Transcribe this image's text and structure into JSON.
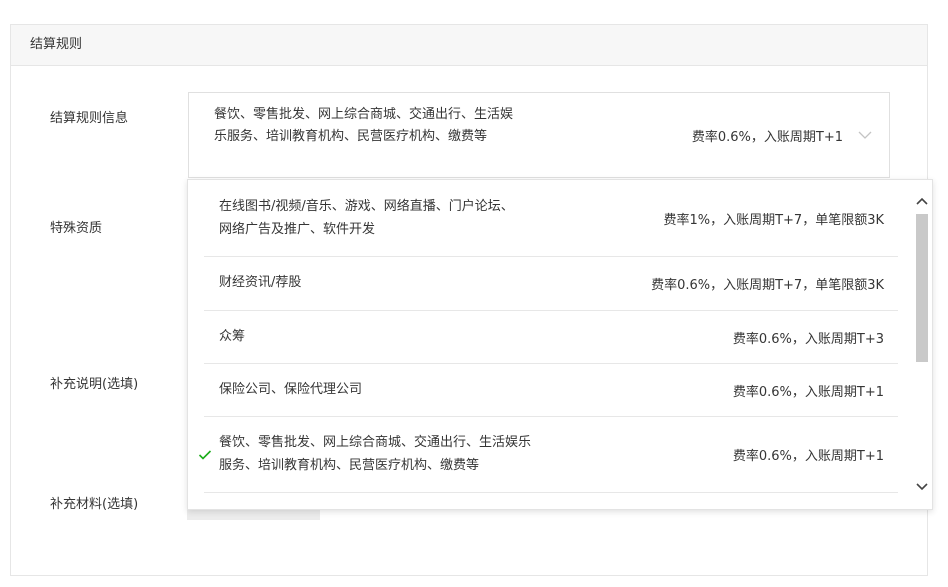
{
  "panel": {
    "title": "结算规则"
  },
  "form": {
    "rule_info_label": "结算规则信息",
    "special_qual_label": "特殊资质",
    "supplement_desc_label": "补充说明(选填)",
    "supplement_material_label": "补充材料(选填)"
  },
  "select": {
    "categories": "餐饮、零售批发、网上综合商城、交通出行、生活娱乐服务、培训教育机构、民营医疗机构、缴费等",
    "rate": "费率0.6%，入账周期T+1"
  },
  "options": [
    {
      "categories": "在线图书/视频/音乐、游戏、网络直播、门户论坛、网络广告及推广、软件开发",
      "rate": "费率1%，入账周期T+7，单笔限额3K",
      "selected": false
    },
    {
      "categories": "财经资讯/荐股",
      "rate": "费率0.6%，入账周期T+7，单笔限额3K",
      "selected": false
    },
    {
      "categories": "众筹",
      "rate": "费率0.6%，入账周期T+3",
      "selected": false
    },
    {
      "categories": "保险公司、保险代理公司",
      "rate": "费率0.6%，入账周期T+1",
      "selected": false
    },
    {
      "categories": "餐饮、零售批发、网上综合商城、交通出行、生活娱乐服务、培训教育机构、民营医疗机构、缴费等",
      "rate": "费率0.6%，入账周期T+1",
      "selected": true
    }
  ],
  "icons": {
    "select_arrow": "chevron-down-icon",
    "selected_mark": "check-icon",
    "scroll_up": "chevron-up-icon",
    "scroll_down": "chevron-down-icon"
  },
  "colors": {
    "check": "#1aad19",
    "border": "#e6e6e6",
    "header_bg": "#f7f7f7"
  }
}
